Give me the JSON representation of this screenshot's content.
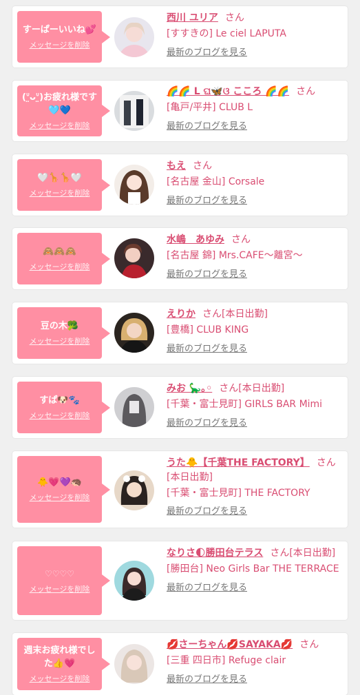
{
  "delete_label": "メッセージを削除",
  "blog_label": "最新のブログを見る",
  "san_suffix": "さん",
  "colors": {
    "bubble": "#ff8fa3",
    "name": "#d94d72",
    "background": "#f0f0f0"
  },
  "items": [
    {
      "message": "すーぱーいいね💕",
      "name": "西川 ユリア",
      "status": "",
      "shop": "[すすきの] Le ciel LAPUTA"
    },
    {
      "message": "(ᐡ̤ᴗᐡ̤)お疲れ様です🩵💙",
      "name": "🌈🌈 L ଘ🦋ଓ こころ 🌈🌈",
      "status": "",
      "shop": "[亀戸/平井] CLUB L"
    },
    {
      "message": "🤍🦒🦒🤍",
      "name": "もえ",
      "status": "",
      "shop": "[名古屋 金山] Corsale"
    },
    {
      "message": "🙈🙈🙈",
      "name": "水嶋　あゆみ",
      "status": "",
      "shop": "[名古屋 錦] Mrs.CAFE～離宮～"
    },
    {
      "message": "豆の木🥦",
      "name": "えりか",
      "status": "[本日出勤]",
      "shop": "[豊橋] CLUB KING"
    },
    {
      "message": "すぱ🐶🐾",
      "name": "みお 🦕｡◦",
      "status": "[本日出勤]",
      "shop": "[千葉・富士見町] GIRLS BAR Mimi"
    },
    {
      "message": "🐥💗💜🦔",
      "name": "うた🐥【千葉THE FACTORY】",
      "status": "[本日出勤]",
      "shop": "[千葉・富士見町] THE FACTORY"
    },
    {
      "message": "♡♡♡♡",
      "name": "なりさ🌓勝田台テラス",
      "status": "[本日出勤]",
      "shop": "[勝田台] Neo Girls Bar THE TERRACE"
    },
    {
      "message": "週末お疲れ様でした👍💗",
      "name": "💋さーちゃん💋SAYAKA💋",
      "status": "",
      "shop": "[三重 四日市] Refuge clair"
    }
  ]
}
